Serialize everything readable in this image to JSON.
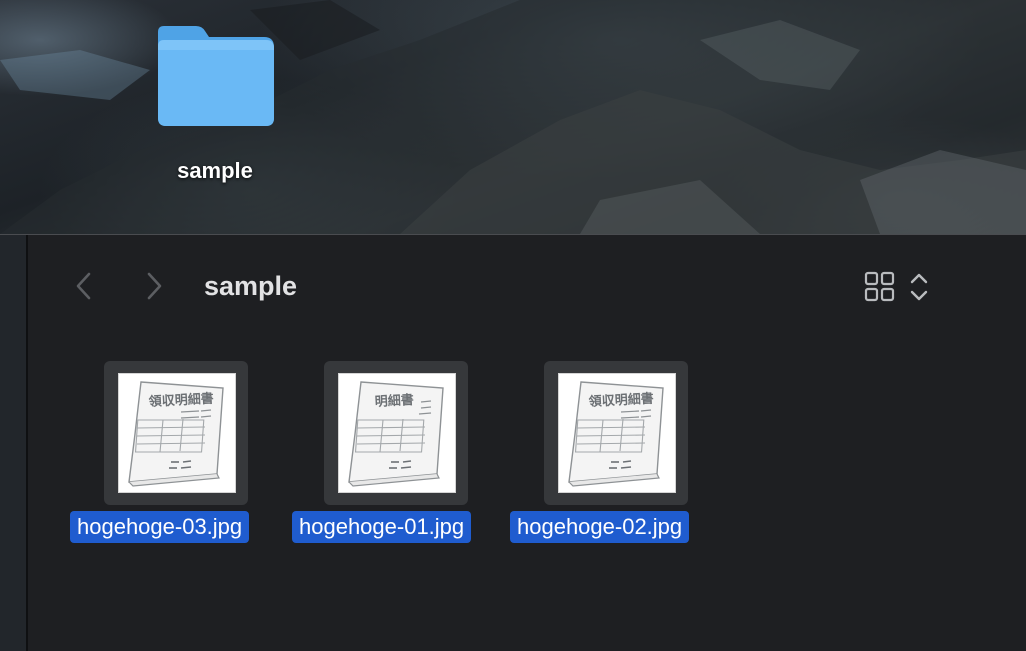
{
  "desktop": {
    "folder": {
      "label": "sample",
      "icon": "folder-icon"
    }
  },
  "window": {
    "title": "sample",
    "back_icon": "chevron-left-icon",
    "forward_icon": "chevron-right-icon",
    "view_icon": "icon-grid-view-icon",
    "view_stepper_icon": "chevron-up-down-icon"
  },
  "files": [
    {
      "name": "hogehoge-03.jpg",
      "doc_title": "領収明細書",
      "selected": true
    },
    {
      "name": "hogehoge-01.jpg",
      "doc_title": "明細書",
      "selected": true
    },
    {
      "name": "hogehoge-02.jpg",
      "doc_title": "領収明細書",
      "selected": true
    }
  ],
  "colors": {
    "selection": "#1f5ccf",
    "folder": "#6ab9f5",
    "window_bg": "#1e1f22"
  }
}
